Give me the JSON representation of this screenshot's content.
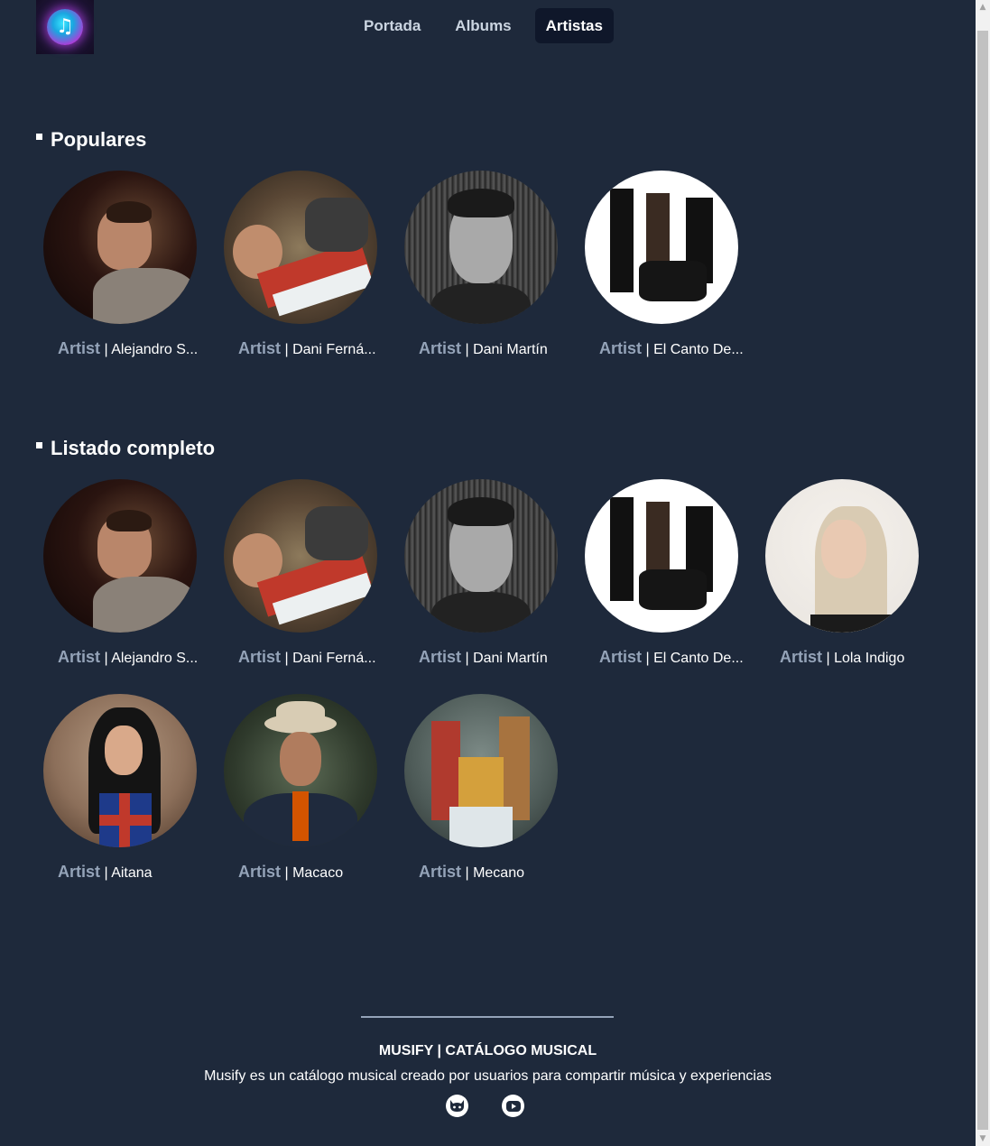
{
  "header": {
    "nav": [
      {
        "label": "Portada",
        "active": false
      },
      {
        "label": "Albums",
        "active": false
      },
      {
        "label": "Artistas",
        "active": true
      }
    ]
  },
  "popular": {
    "title": "Populares",
    "items": [
      {
        "kind": "Artist",
        "name": "Alejandro S..."
      },
      {
        "kind": "Artist",
        "name": "Dani Ferná..."
      },
      {
        "kind": "Artist",
        "name": "Dani Martín"
      },
      {
        "kind": "Artist",
        "name": "El Canto De..."
      }
    ]
  },
  "full_list": {
    "title": "Listado completo",
    "items": [
      {
        "kind": "Artist",
        "name": "Alejandro S..."
      },
      {
        "kind": "Artist",
        "name": "Dani Ferná..."
      },
      {
        "kind": "Artist",
        "name": "Dani Martín"
      },
      {
        "kind": "Artist",
        "name": "El Canto De..."
      },
      {
        "kind": "Artist",
        "name": "Lola Indigo"
      },
      {
        "kind": "Artist",
        "name": "Aitana"
      },
      {
        "kind": "Artist",
        "name": "Macaco"
      },
      {
        "kind": "Artist",
        "name": "Mecano"
      }
    ]
  },
  "footer": {
    "title": "MUSIFY | CATÁLOGO MUSICAL",
    "description": "Musify es un catálogo musical creado por usuarios para compartir música y experiencias",
    "icons": [
      "github-icon",
      "youtube-icon"
    ]
  },
  "colors": {
    "background": "#1e293b",
    "nav_active": "#0f172a",
    "muted_text": "#94a3b8"
  }
}
